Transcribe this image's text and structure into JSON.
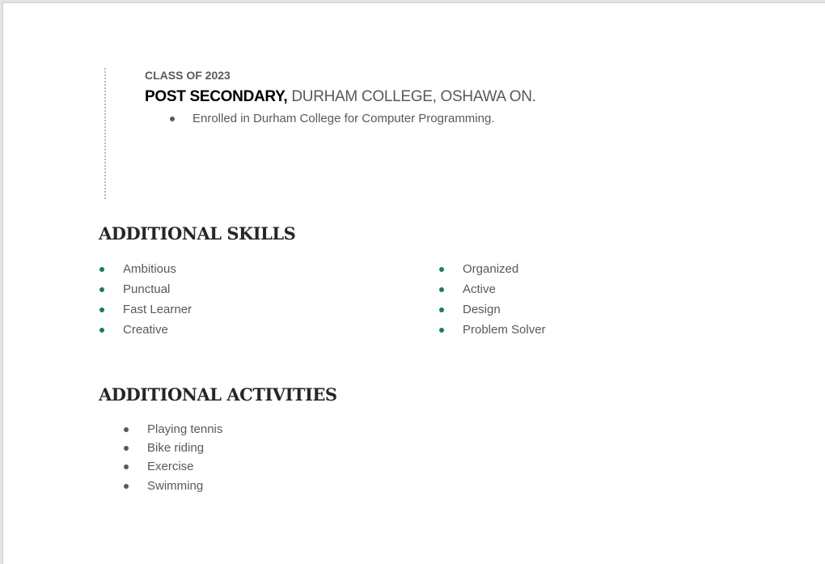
{
  "education": {
    "class_label": "CLASS OF 2023",
    "degree": "POST SECONDARY,",
    "school": " DURHAM COLLEGE, OSHAWA ON.",
    "bullets": [
      "Enrolled in Durham College for Computer Programming."
    ]
  },
  "skills": {
    "heading": "ADDITIONAL SKILLS",
    "left": [
      "Ambitious",
      "Punctual",
      "Fast Learner",
      "Creative"
    ],
    "right": [
      "Organized",
      "Active",
      "Design",
      "Problem Solver"
    ],
    "bullet_color": "#1e7d4f"
  },
  "activities": {
    "heading": "ADDITIONAL ACTIVITIES",
    "items": [
      "Playing tennis",
      "Bike riding",
      "Exercise",
      "Swimming"
    ]
  }
}
